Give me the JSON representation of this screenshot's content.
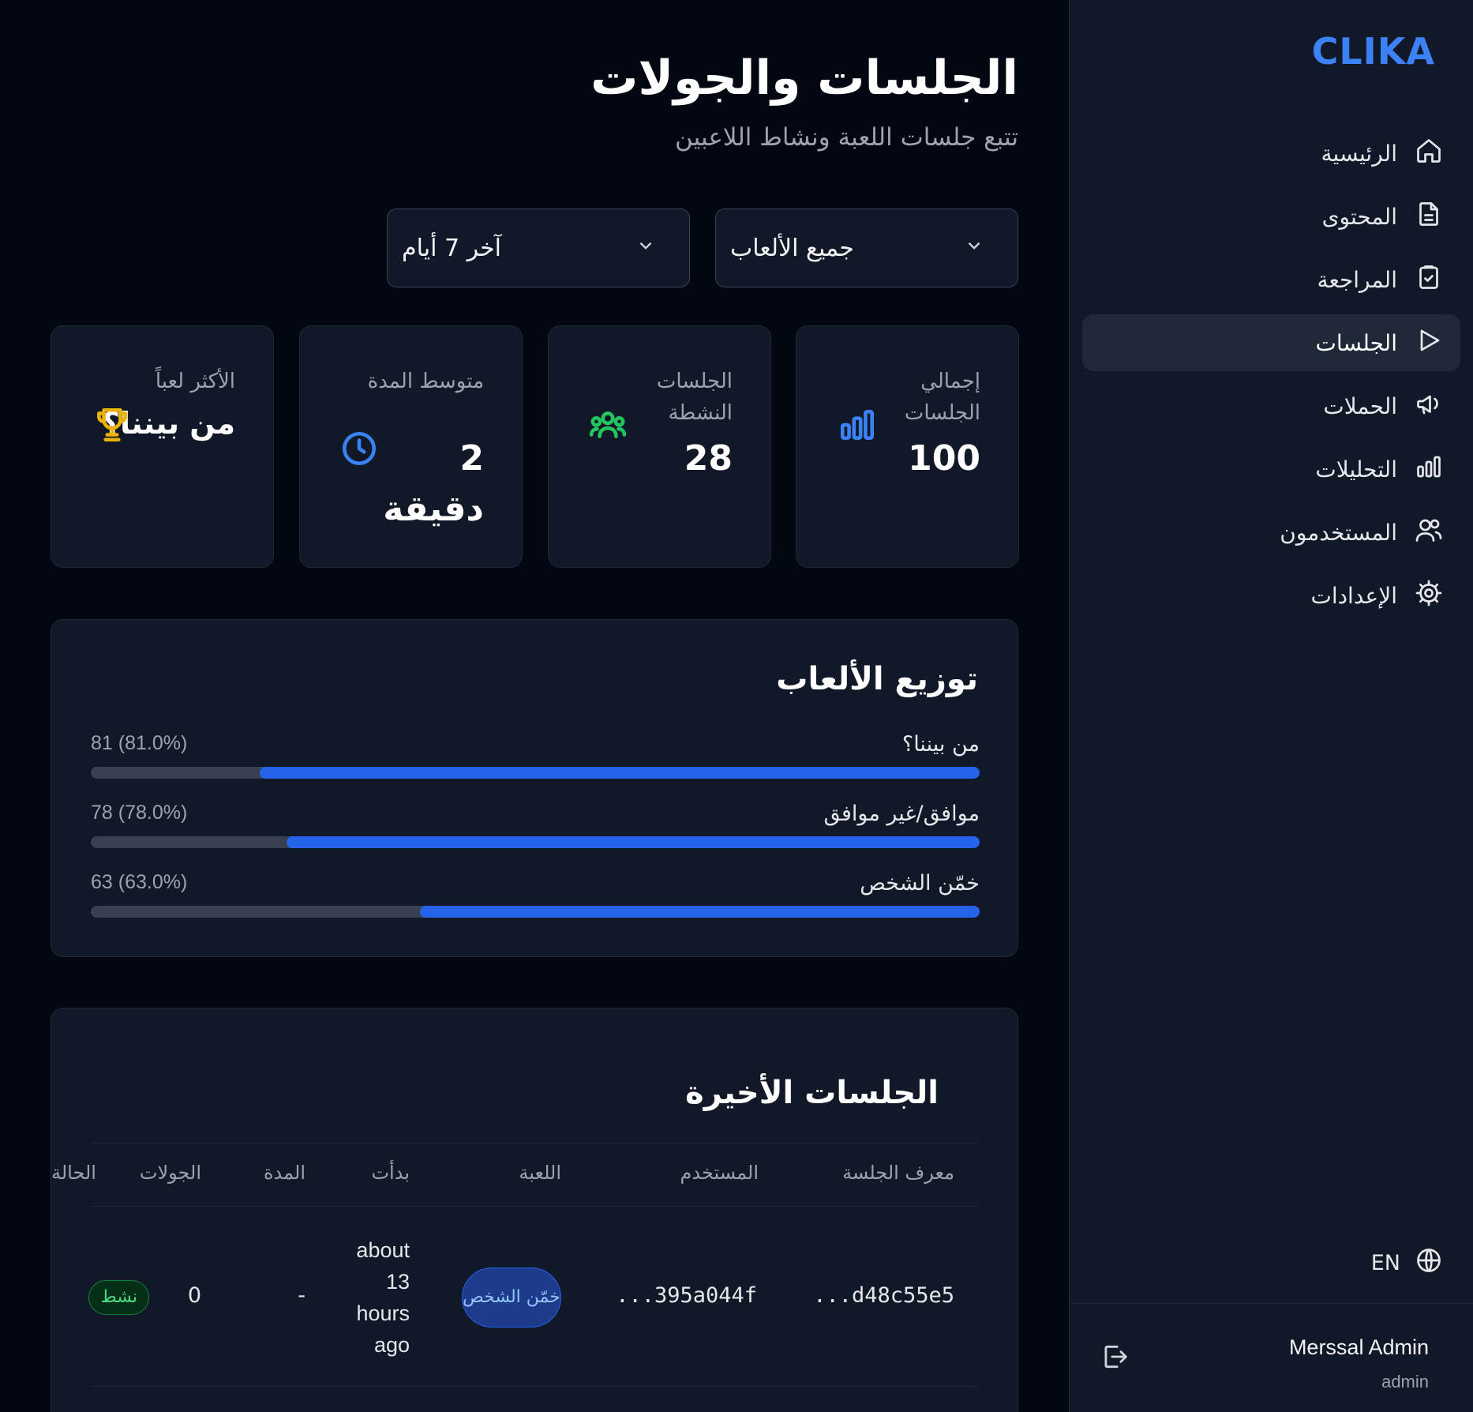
{
  "brand": "CLIKA",
  "nav": [
    {
      "label": "الرئيسية",
      "icon": "home-icon"
    },
    {
      "label": "المحتوى",
      "icon": "document-icon"
    },
    {
      "label": "المراجعة",
      "icon": "clipboard-check-icon"
    },
    {
      "label": "الجلسات",
      "icon": "play-icon",
      "active": true
    },
    {
      "label": "الحملات",
      "icon": "megaphone-icon"
    },
    {
      "label": "التحليلات",
      "icon": "bar-chart-icon"
    },
    {
      "label": "المستخدمون",
      "icon": "users-icon"
    },
    {
      "label": "الإعدادات",
      "icon": "gear-icon"
    }
  ],
  "language": {
    "label": "EN",
    "icon": "globe-icon"
  },
  "user": {
    "name": "Merssal Admin",
    "role": "admin"
  },
  "header": {
    "title": "الجلسات والجولات",
    "subtitle": "تتبع جلسات اللعبة ونشاط اللاعبين"
  },
  "filters": {
    "game": "جميع الألعاب",
    "period": "آخر 7 أيام"
  },
  "stats": [
    {
      "label": "إجمالي الجلسات",
      "value": "100",
      "icon": "bar-chart-icon",
      "color": "#3b82f6"
    },
    {
      "label": "الجلسات النشطة",
      "value": "28",
      "icon": "users-group-icon",
      "color": "#22c55e"
    },
    {
      "label": "متوسط المدة",
      "value": "2 دقيقة",
      "icon": "clock-icon",
      "color": "#3b82f6"
    },
    {
      "label": "الأكثر لعباً",
      "value": "من بيننا؟",
      "icon": "trophy-icon",
      "color": "#eab308"
    }
  ],
  "distribution": {
    "title": "توزيع الألعاب",
    "items": [
      {
        "name": "من بيننا؟",
        "count": "81 (81.0%)",
        "percent": 81
      },
      {
        "name": "موافق/غير موافق",
        "count": "78 (78.0%)",
        "percent": 78
      },
      {
        "name": "خمّن الشخص",
        "count": "63 (63.0%)",
        "percent": 63
      }
    ]
  },
  "recent": {
    "title": "الجلسات الأخيرة",
    "columns": [
      "معرف الجلسة",
      "المستخدم",
      "اللعبة",
      "بدأت",
      "المدة",
      "الجولات",
      "الحالة"
    ],
    "rows": [
      {
        "session_id": "...d48c55e5",
        "user": "...395a044f",
        "game": "خمّن الشخص",
        "started": "about 13 hours ago",
        "duration": "-",
        "rounds": "0",
        "status": "نشط"
      }
    ]
  },
  "colors": {
    "accent": "#3b82f6",
    "bar": "#2563eb",
    "success": "#22c55e",
    "trophy": "#eab308"
  }
}
